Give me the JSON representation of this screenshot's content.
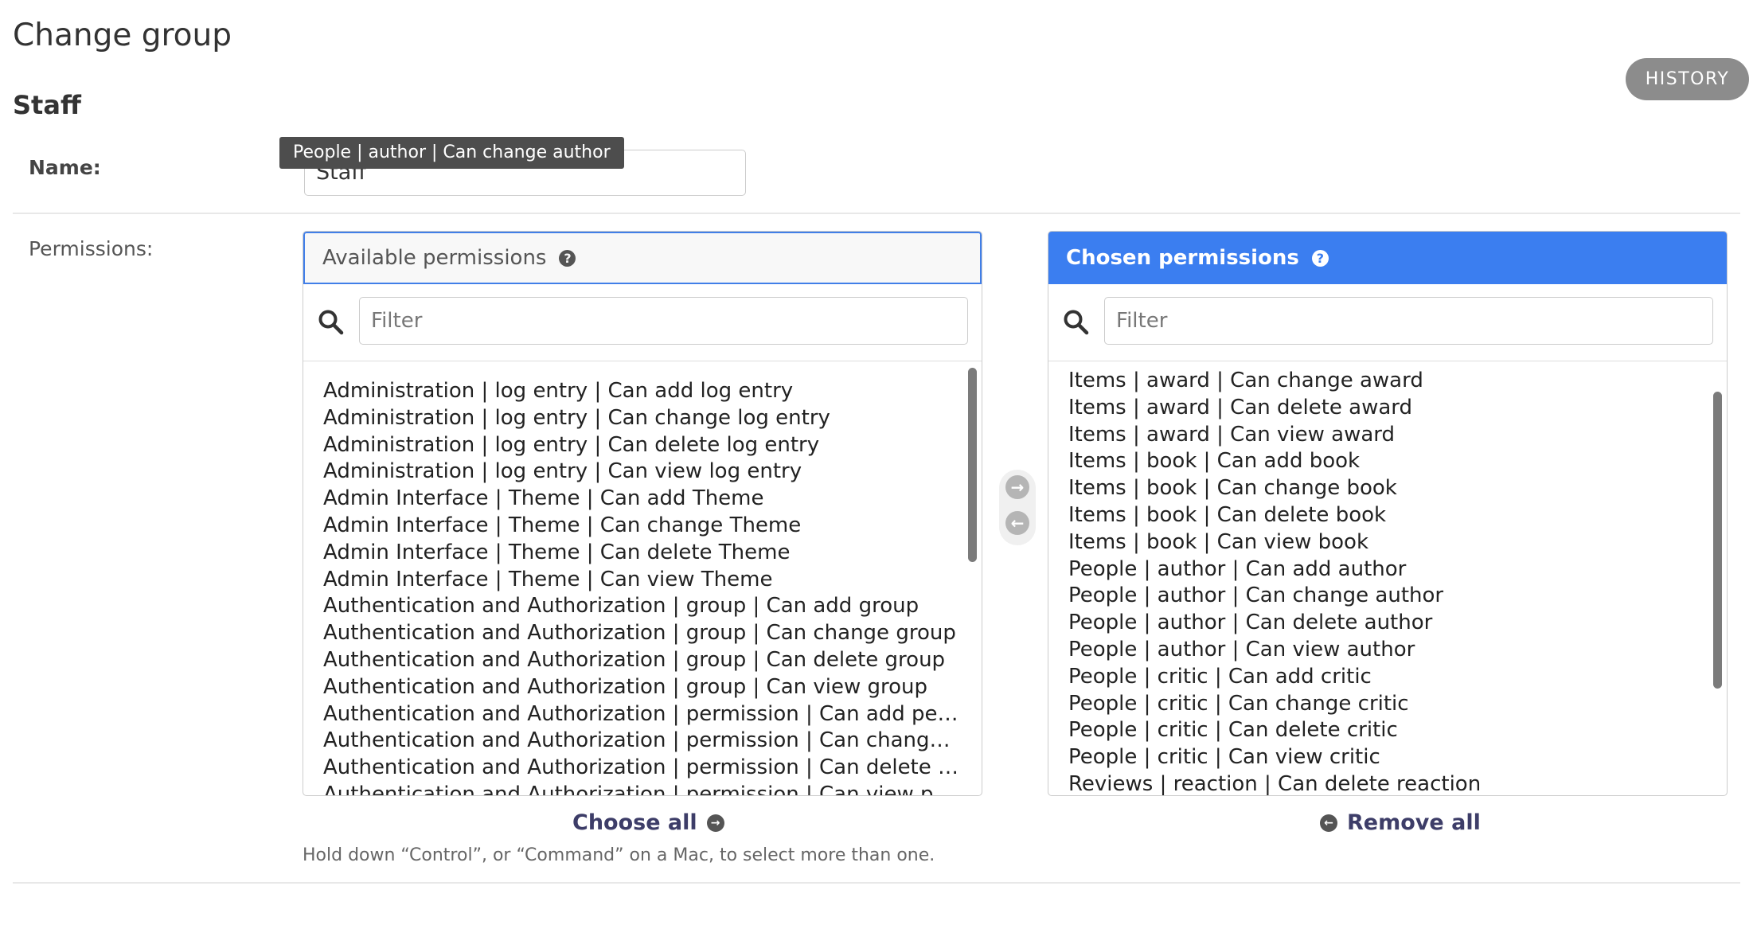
{
  "page": {
    "title": "Change group",
    "object_name": "Staff",
    "history_label": "HISTORY"
  },
  "name_field": {
    "label": "Name:",
    "value": "Staff"
  },
  "tooltip": "People | author | Can change author",
  "permissions": {
    "label": "Permissions:",
    "available": {
      "title": "Available permissions",
      "help_icon": "question-circle-icon",
      "filter_placeholder": "Filter",
      "items": [
        "Administration | log entry | Can add log entry",
        "Administration | log entry | Can change log entry",
        "Administration | log entry | Can delete log entry",
        "Administration | log entry | Can view log entry",
        "Admin Interface | Theme | Can add Theme",
        "Admin Interface | Theme | Can change Theme",
        "Admin Interface | Theme | Can delete Theme",
        "Admin Interface | Theme | Can view Theme",
        "Authentication and Authorization | group | Can add group",
        "Authentication and Authorization | group | Can change group",
        "Authentication and Authorization | group | Can delete group",
        "Authentication and Authorization | group | Can view group",
        "Authentication and Authorization | permission | Can add permis...",
        "Authentication and Authorization | permission | Can change per...",
        "Authentication and Authorization | permission | Can delete per...",
        "Authentication and Authorization | permission | Can view permi..."
      ],
      "choose_all_label": "Choose all"
    },
    "chosen": {
      "title": "Chosen permissions",
      "help_icon": "question-circle-icon",
      "filter_placeholder": "Filter",
      "items": [
        "Items | award | Can change award",
        "Items | award | Can delete award",
        "Items | award | Can view award",
        "Items | book | Can add book",
        "Items | book | Can change book",
        "Items | book | Can delete book",
        "Items | book | Can view book",
        "People | author | Can add author",
        "People | author | Can change author",
        "People | author | Can delete author",
        "People | author | Can view author",
        "People | critic | Can add critic",
        "People | critic | Can change critic",
        "People | critic | Can delete critic",
        "People | critic | Can view critic",
        "Reviews | reaction | Can delete reaction"
      ],
      "remove_all_label": "Remove all"
    },
    "help_text": "Hold down “Control”, or “Command” on a Mac, to select more than one."
  },
  "colors": {
    "accent": "#3b7ef0",
    "link": "#3d3d68",
    "history_bg": "#8c8c8c",
    "tooltip_bg": "#4d4d4d"
  }
}
